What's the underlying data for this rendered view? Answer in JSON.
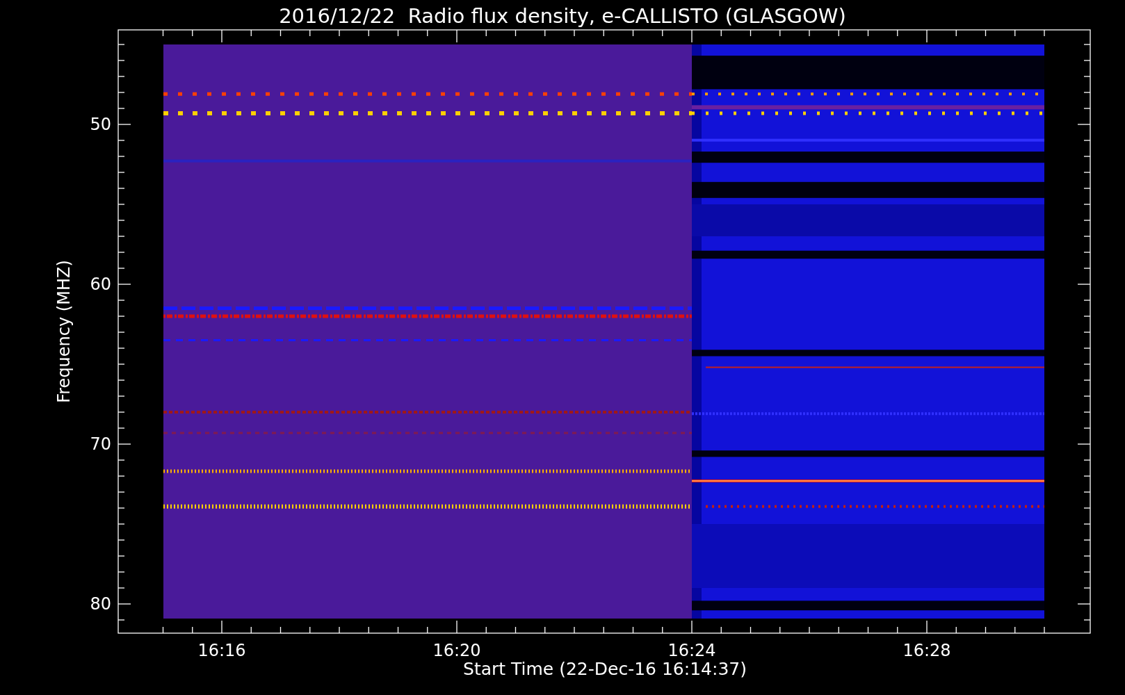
{
  "title": "2016/12/22  Radio flux density, e-CALLISTO (GLASGOW)",
  "y_axis": {
    "label": "Frequency (MHZ)",
    "ticks": [
      "50",
      "60",
      "70",
      "80"
    ]
  },
  "x_axis": {
    "label": "Start Time (22-Dec-16 16:14:37)",
    "ticks": [
      "16:16",
      "16:20",
      "16:24",
      "16:28"
    ]
  }
}
